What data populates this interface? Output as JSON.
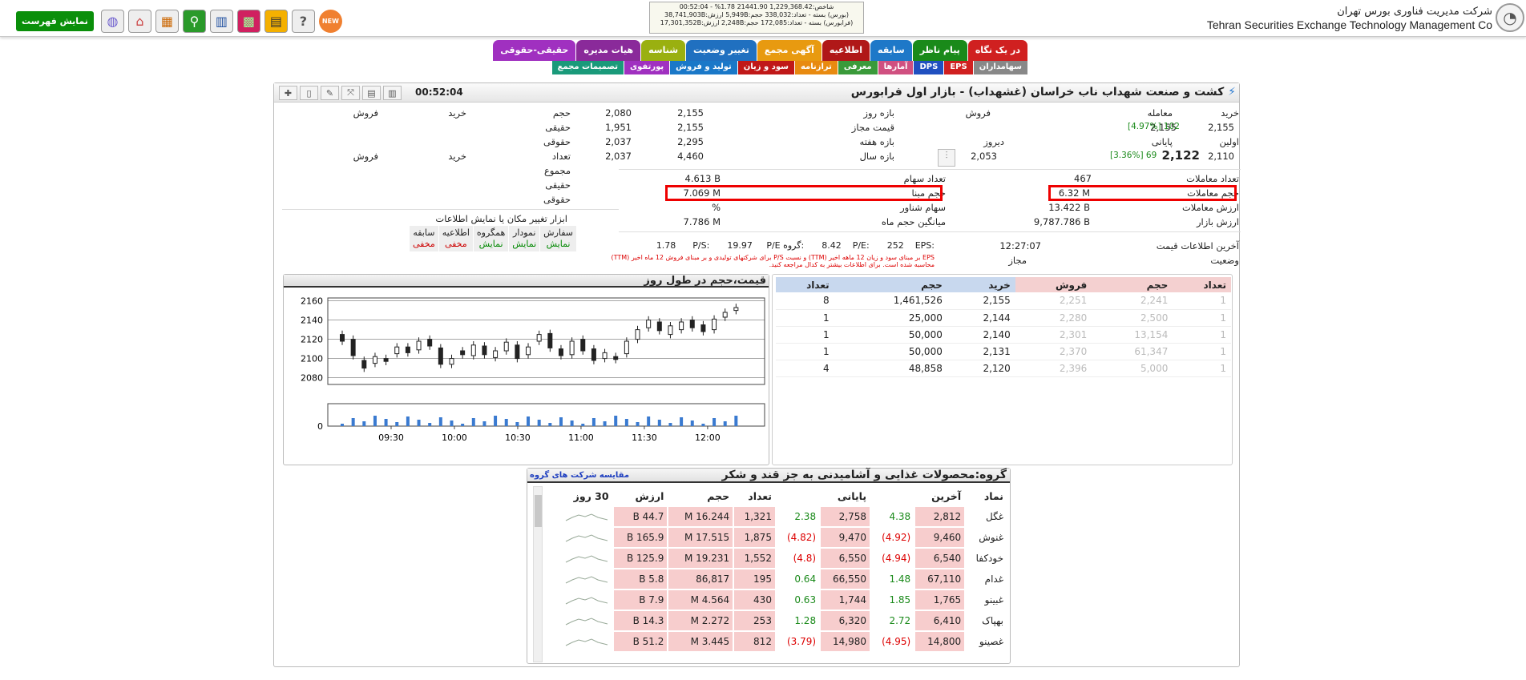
{
  "header": {
    "company_fa": "شرکت مدیریت فناوری بورس تهران",
    "company_en": "Tehran Securities Exchange Technology Management Co",
    "ticker_line1": "شاخص:1,229,368.42 21441.90 1.78% - 00:52:04",
    "ticker_line2": "(بورس) بسته - تعداد:338,032 حجم:5,949B ارزش:38,741,903B",
    "ticker_line3": "(فرابورس) بسته - تعداد:172,085 حجم:2,248B ارزش:17,301,352B",
    "show_list": "نمایش فهرست",
    "new_badge": "NEW"
  },
  "tabs_row1": [
    {
      "label": "در یک نگاه",
      "color": "#d02020"
    },
    {
      "label": "پیام ناظر",
      "color": "#1a8a1a"
    },
    {
      "label": "سابقه",
      "color": "#1e78c8"
    },
    {
      "label": "اطلاعیه",
      "color": "#b01818"
    },
    {
      "label": "آگهی مجمع",
      "color": "#e89a10"
    },
    {
      "label": "تغییر وضعیت",
      "color": "#2070c0"
    },
    {
      "label": "شناسه",
      "color": "#9ab010"
    },
    {
      "label": "هیات مدیره",
      "color": "#8a2a9a"
    },
    {
      "label": "حقیقی-حقوقی",
      "color": "#a030c0"
    }
  ],
  "tabs_row2": [
    {
      "label": "سهامداران",
      "color": "#888"
    },
    {
      "label": "EPS",
      "color": "#d02020"
    },
    {
      "label": "DPS",
      "color": "#2050c0"
    },
    {
      "label": "آمارها",
      "color": "#d05080"
    },
    {
      "label": "معرفی",
      "color": "#3a9a3a"
    },
    {
      "label": "ترازنامه",
      "color": "#e88a10"
    },
    {
      "label": "سود و زیان",
      "color": "#c01818"
    },
    {
      "label": "تولید و فروش",
      "color": "#1a78c8"
    },
    {
      "label": "پورتفوی",
      "color": "#a030c0"
    },
    {
      "label": "تصمیمات مجمع",
      "color": "#1a9a7a"
    }
  ],
  "panel": {
    "title": "کشت و صنعت شهداب ناب خراسان (غشهداب) - بازار اول فرابورس",
    "time": "00:52:04"
  },
  "price": {
    "buy_lbl": "خرید",
    "trade_lbl": "معامله",
    "sell_lbl": "فروش",
    "first_lbl": "اولین",
    "final_lbl": "پایانی",
    "yday_lbl": "دیروز",
    "buy": "2,155",
    "trade": "2,155",
    "trade_pct": "[4.97%]",
    "trade_chg": "102",
    "first": "2,110",
    "final": "2,122",
    "final_pct": "[3.36%]",
    "final_chg": "69",
    "yday": "2,053",
    "day_range_lbl": "بازه روز",
    "day_lo": "2,080",
    "day_hi": "2,155",
    "allowed_lbl": "قیمت مجاز",
    "allowed_lo": "1,951",
    "allowed_hi": "2,155",
    "week_lbl": "بازه هفته",
    "week_lo": "2,037",
    "week_hi": "2,295",
    "year_lbl": "بازه سال",
    "year_lo": "2,037",
    "year_hi": "4,460"
  },
  "stats": {
    "count_lbl": "تعداد معاملات",
    "count": "467",
    "vol_lbl": "حجم معاملات",
    "vol": "6.32 M",
    "value_lbl": "ارزش معاملات",
    "value": "13.422 B",
    "mcap_lbl": "ارزش بازار",
    "mcap": "9,787.786 B",
    "shares_lbl": "تعداد سهام",
    "shares": "4.613 B",
    "base_lbl": "حجم مبنا",
    "base": "7.069 M",
    "float_lbl": "سهام شناور",
    "float": "%",
    "avg_lbl": "میانگین حجم ماه",
    "avg": "7.786 M",
    "last_lbl": "آخرین اطلاعات قیمت",
    "last": "12:27:07",
    "status_lbl": "وضعیت",
    "status": "مجاز",
    "eps_lbl": "EPS:",
    "eps": "252",
    "pe_lbl": "P/E:",
    "pe": "8.42",
    "gpe_lbl": "P/E گروه:",
    "gpe": "19.97",
    "ps_lbl": "P/S:",
    "ps": "1.78",
    "note1": "EPS بر مبنای سود و زیان 12 ماهه اخیر (TTM) و نسبت P/S برای شرکتهای تولیدی و بر مبنای فروش 12 ماه اخیر (TTM)",
    "note2": "محاسبه شده است. برای اطلاعات بیشتر به کدال مراجعه کنید."
  },
  "legal": {
    "vol": "حجم",
    "buy": "خرید",
    "sell": "فروش",
    "real": "حقیقی",
    "legal": "حقوقی",
    "count": "تعداد",
    "sum": "مجموع",
    "tool_title": "ابزار تغییر مکان یا نمایش اطلاعات",
    "toggles": [
      {
        "l": "سفارش",
        "v": "نمایش"
      },
      {
        "l": "نمودار",
        "v": "نمایش"
      },
      {
        "l": "همگروه",
        "v": "نمایش"
      },
      {
        "l": "اطلاعیه",
        "v": "مخفی"
      },
      {
        "l": "سابقه",
        "v": "مخفی"
      }
    ]
  },
  "orderbook": {
    "headers": [
      "تعداد",
      "حجم",
      "خرید",
      "فروش",
      "حجم",
      "تعداد"
    ],
    "rows": [
      [
        "8",
        "1,461,526",
        "2,155",
        "2,251",
        "2,241",
        "1"
      ],
      [
        "1",
        "25,000",
        "2,144",
        "2,280",
        "2,500",
        "1"
      ],
      [
        "1",
        "50,000",
        "2,140",
        "2,301",
        "13,154",
        "1"
      ],
      [
        "1",
        "50,000",
        "2,131",
        "2,370",
        "61,347",
        "1"
      ],
      [
        "4",
        "48,858",
        "2,120",
        "2,396",
        "5,000",
        "1"
      ]
    ]
  },
  "chart": {
    "title": "قیمت،حجم در طول روز",
    "yticks": [
      "2160",
      "2140",
      "2120",
      "2100",
      "2080"
    ],
    "vol_zero": "0",
    "xticks": [
      "09:30",
      "10:00",
      "10:30",
      "11:00",
      "11:30",
      "12:00"
    ],
    "chart_data": {
      "type": "candlestick",
      "ylim": [
        2073,
        2163
      ],
      "xrange": [
        "09:00",
        "12:27"
      ],
      "xticks": [
        "09:30",
        "10:00",
        "10:30",
        "11:00",
        "11:30",
        "12:00"
      ]
    }
  },
  "group": {
    "title": "گروه:محصولات غذایی و آشامیدنی به جز قند و شکر",
    "compare": "مقایسه شرکت های گروه",
    "headers": [
      "نماد",
      "آخرین",
      "",
      "پایانی",
      "",
      "تعداد",
      "حجم",
      "ارزش",
      "30 روز"
    ],
    "rows": [
      [
        "غگل",
        "2,812",
        "4.38",
        "2,758",
        "2.38",
        "1,321",
        "16.244 M",
        "44.7 B"
      ],
      [
        "غنوش",
        "9,460",
        "(4.92)",
        "9,470",
        "(4.82)",
        "1,875",
        "17.515 M",
        "165.9 B"
      ],
      [
        "خودکفا",
        "6,540",
        "(4.94)",
        "6,550",
        "(4.8)",
        "1,552",
        "19.231 M",
        "125.9 B"
      ],
      [
        "غدام",
        "67,110",
        "1.48",
        "66,550",
        "0.64",
        "195",
        "86,817",
        "5.8 B"
      ],
      [
        "غبینو",
        "1,765",
        "1.85",
        "1,744",
        "0.63",
        "430",
        "4.564 M",
        "7.9 B"
      ],
      [
        "بهپاک",
        "6,410",
        "2.72",
        "6,320",
        "1.28",
        "253",
        "2.272 M",
        "14.3 B"
      ],
      [
        "غصینو",
        "14,800",
        "(4.95)",
        "14,980",
        "(3.79)",
        "812",
        "3.445 M",
        "51.2 B"
      ]
    ]
  }
}
